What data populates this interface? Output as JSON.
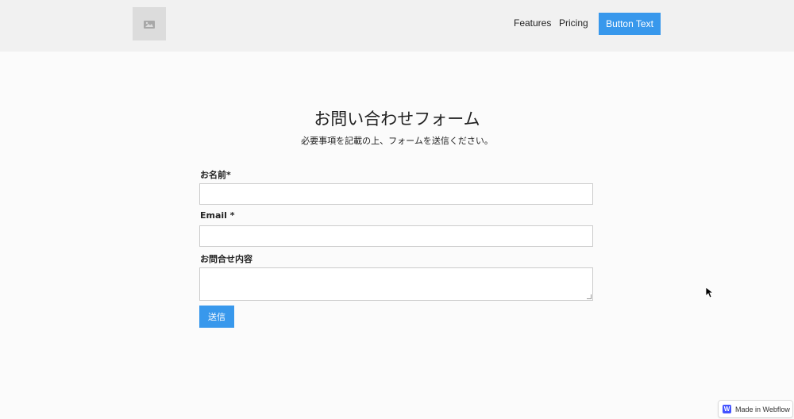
{
  "nav": {
    "logo_icon": "image-placeholder-icon",
    "links": [
      "Features",
      "Pricing"
    ],
    "button_label": "Button Text",
    "accent_color": "#3898ec"
  },
  "form": {
    "title": "お問い合わせフォーム",
    "subtitle": "必要事項を記載の上、フォームを送信ください。",
    "name_label": "お名前*",
    "name_value": "",
    "email_label": "Email *",
    "email_value": "",
    "message_label": "お問合せ内容",
    "message_value": "",
    "submit_label": "送信"
  },
  "badge": {
    "logo_letter": "W",
    "text": "Made in Webflow"
  }
}
